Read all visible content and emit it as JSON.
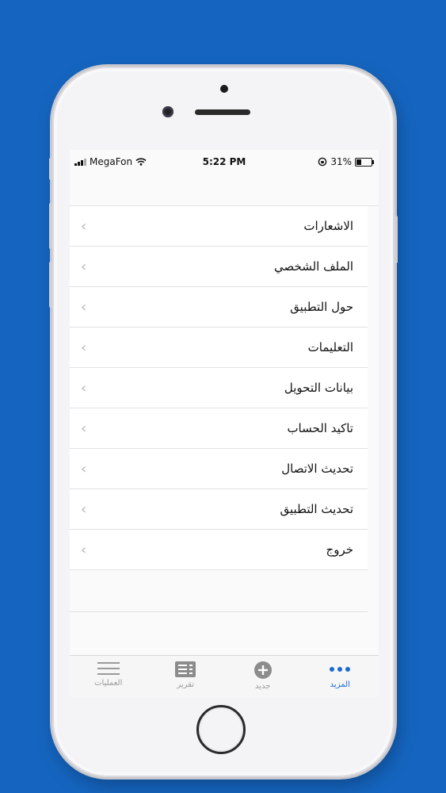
{
  "status": {
    "carrier": "MegaFon",
    "time": "5:22 PM",
    "battery": "31%",
    "battery_level": 0.31
  },
  "menu": {
    "items": [
      {
        "label": "الاشعارات"
      },
      {
        "label": "الملف الشخصي"
      },
      {
        "label": "حول التطبيق"
      },
      {
        "label": "التعليمات"
      },
      {
        "label": "بيانات التحويل"
      },
      {
        "label": "تاكيد الحساب"
      },
      {
        "label": "تحديث الاتصال"
      },
      {
        "label": "تحديث التطبيق"
      },
      {
        "label": "خروج"
      }
    ]
  },
  "tabs": [
    {
      "label": "العمليات",
      "icon": "menu-lines-icon"
    },
    {
      "label": "تقرير",
      "icon": "report-icon"
    },
    {
      "label": "جديد",
      "icon": "plus-circle-icon"
    },
    {
      "label": "المزيد",
      "icon": "more-dots-icon",
      "active": true
    }
  ],
  "colors": {
    "background": "#1565c0",
    "accent": "#1a6ad0",
    "tab_inactive": "#999999"
  }
}
